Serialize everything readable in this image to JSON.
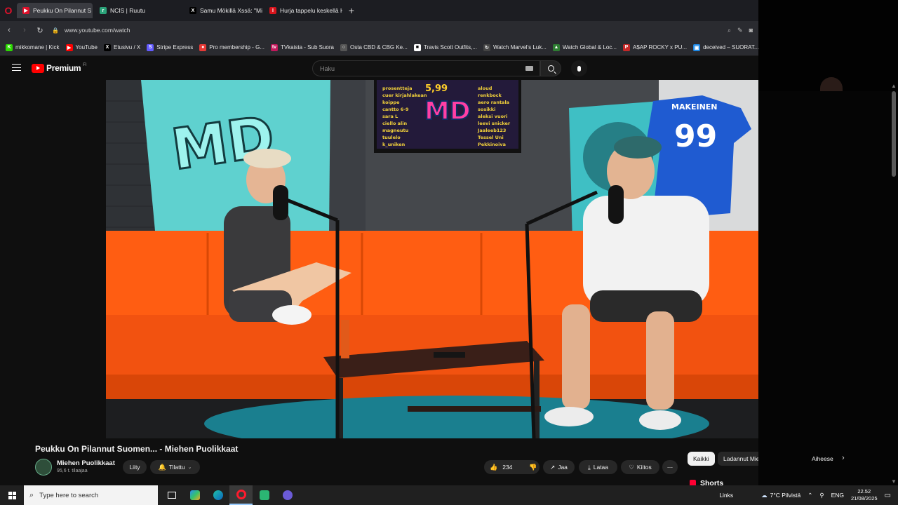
{
  "tabs": [
    {
      "label": "Peukku On Pilannut S",
      "color": "#e0112b",
      "glyph": "▶",
      "active": true
    },
    {
      "label": "NCIS | Ruutu",
      "color": "#2ba37a",
      "glyph": "r",
      "active": false
    },
    {
      "label": "Samu Mökillä Xssä: \"Mini",
      "color": "#000000",
      "glyph": "X",
      "active": false
    },
    {
      "label": "Hurja tappelu keskellä He",
      "color": "#d8141c",
      "glyph": "I",
      "active": false
    }
  ],
  "address": {
    "url": "www.youtube.com/watch"
  },
  "bookmarks": [
    {
      "label": "mikkomane | Kick",
      "color": "#2bd900",
      "glyph": "K"
    },
    {
      "label": "YouTube",
      "color": "#ff0000",
      "glyph": "▶"
    },
    {
      "label": "Etusivu / X",
      "color": "#000000",
      "glyph": "X"
    },
    {
      "label": "Stripe Express",
      "color": "#635bff",
      "glyph": "S"
    },
    {
      "label": "Pro membership - G...",
      "color": "#e53935",
      "glyph": "●"
    },
    {
      "label": "TVkaista - Sub Suora",
      "color": "#c2185b",
      "glyph": "tv"
    },
    {
      "label": "Osta CBD & CBG Ke...",
      "color": "#555555",
      "glyph": "○"
    },
    {
      "label": "Travis Scott Outfits,...",
      "color": "#ffffff",
      "glyph": "■"
    },
    {
      "label": "Watch Marvel's Luk...",
      "color": "#444444",
      "glyph": "↻"
    },
    {
      "label": "Watch Global & Loc...",
      "color": "#2e7d32",
      "glyph": "▲"
    },
    {
      "label": "A$AP ROCKY x PU...",
      "color": "#c62828",
      "glyph": "P"
    },
    {
      "label": "deceived – SUORAT...",
      "color": "#1e88e5",
      "glyph": "▣"
    }
  ],
  "youtube": {
    "logo_word": "Premium",
    "region": "FI",
    "search_placeholder": "Haku"
  },
  "video": {
    "title": "Peukku On Pilannut Suomen... - Miehen Puolikkaat",
    "tv_price": "5,99",
    "tv_brand": "MD",
    "jersey_name": "MAKEINEN",
    "jersey_number": "99"
  },
  "channel": {
    "name": "Miehen Puolikkaat",
    "subscribers": "95,6 t. tilaajaa",
    "join_label": "Liity",
    "subscribed_label": "Tilattu"
  },
  "actions": {
    "likes": "234",
    "share_label": "Jaa",
    "download_label": "Lataa",
    "thanks_label": "Kiitos"
  },
  "chips": [
    "Kaikki",
    "Ladannut Miehen Puolikkaat",
    "Aiheese"
  ],
  "shorts_label": "Shorts",
  "taskbar": {
    "search_placeholder": "Type here to search",
    "links_label": "Links",
    "weather": "7°C  Pilvistä",
    "language": "ENG",
    "time": "22.52",
    "date": "21/08/2025"
  }
}
